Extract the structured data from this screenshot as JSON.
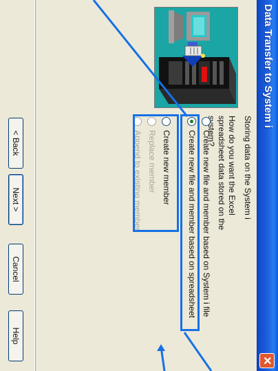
{
  "window": {
    "title": "Data Transfer to System i",
    "close_glyph": "✕"
  },
  "content": {
    "heading": "Storing data on the System i",
    "question": "How do you want the Excel spreadsheet data stored on the system?"
  },
  "file_options": [
    {
      "label": "Create new file and member based on System i file",
      "checked": false,
      "enabled": true
    },
    {
      "label": "Create new file and member based on spreadsheet",
      "checked": true,
      "enabled": true
    }
  ],
  "member_options": [
    {
      "label": "Create new member",
      "checked": false,
      "enabled": true
    },
    {
      "label": "Replace member",
      "checked": false,
      "enabled": false
    },
    {
      "label": "Append to existing member",
      "checked": false,
      "enabled": false
    }
  ],
  "buttons": {
    "back": "< Back",
    "next": "Next >",
    "cancel": "Cancel",
    "help": "Help"
  },
  "colors": {
    "dialog_bg": "#ECE9D8",
    "title_bar": "#1C5EDC",
    "highlight": "#1670E6",
    "illustration_bg": "#1BA5A5"
  },
  "icons": {
    "close": "close-icon",
    "illustration": "system-i-transfer-illustration"
  }
}
